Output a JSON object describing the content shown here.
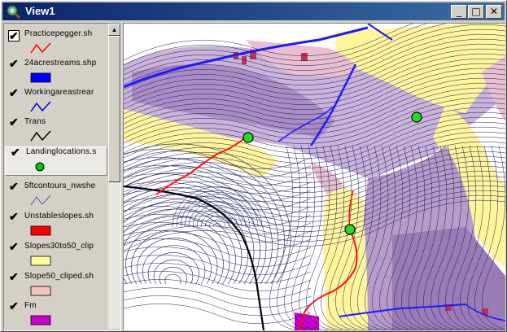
{
  "window": {
    "title": "View1",
    "controls": {
      "minimize": "_",
      "maximize": "□",
      "close": "✕"
    }
  },
  "toc": {
    "layers": [
      {
        "label": "Practicepegger.sh",
        "checked": true,
        "symbol": "red-line",
        "color": "#ff0000"
      },
      {
        "label": "24acrestreams.shp",
        "checked": true,
        "symbol": "blue-fill",
        "color": "#0000ff"
      },
      {
        "label": "Workingareastrear",
        "checked": true,
        "symbol": "blue-line",
        "color": "#0000cc"
      },
      {
        "label": "Trans",
        "checked": true,
        "symbol": "black-line",
        "color": "#000000"
      },
      {
        "label": "Landinglocations.s",
        "checked": true,
        "symbol": "green-point",
        "color": "#00cc00"
      },
      {
        "label": "5ftcontours_nwshe",
        "checked": true,
        "symbol": "navy-line",
        "color": "#3b3b8a"
      },
      {
        "label": "Unstableslopes.sh",
        "checked": true,
        "symbol": "red-fill",
        "color": "#ff0000"
      },
      {
        "label": "Slopes30to50_clip",
        "checked": true,
        "symbol": "yellow-fill",
        "color": "#ffff99"
      },
      {
        "label": "Slope50_cliped.sh",
        "checked": true,
        "symbol": "pink-fill",
        "color": "#f4c2c2"
      },
      {
        "label": "Fm",
        "checked": true,
        "symbol": "purple-fill",
        "color": "#cc00cc"
      }
    ]
  },
  "map": {
    "colors": {
      "contour": "#1a1a5e",
      "yellow": "#fff59a",
      "pink": "#e9bfcf",
      "purple": "#b69ac8",
      "stream": "#1a1aff",
      "road": "#ff1010",
      "trans": "#000000",
      "landing": "#22dd22"
    }
  }
}
